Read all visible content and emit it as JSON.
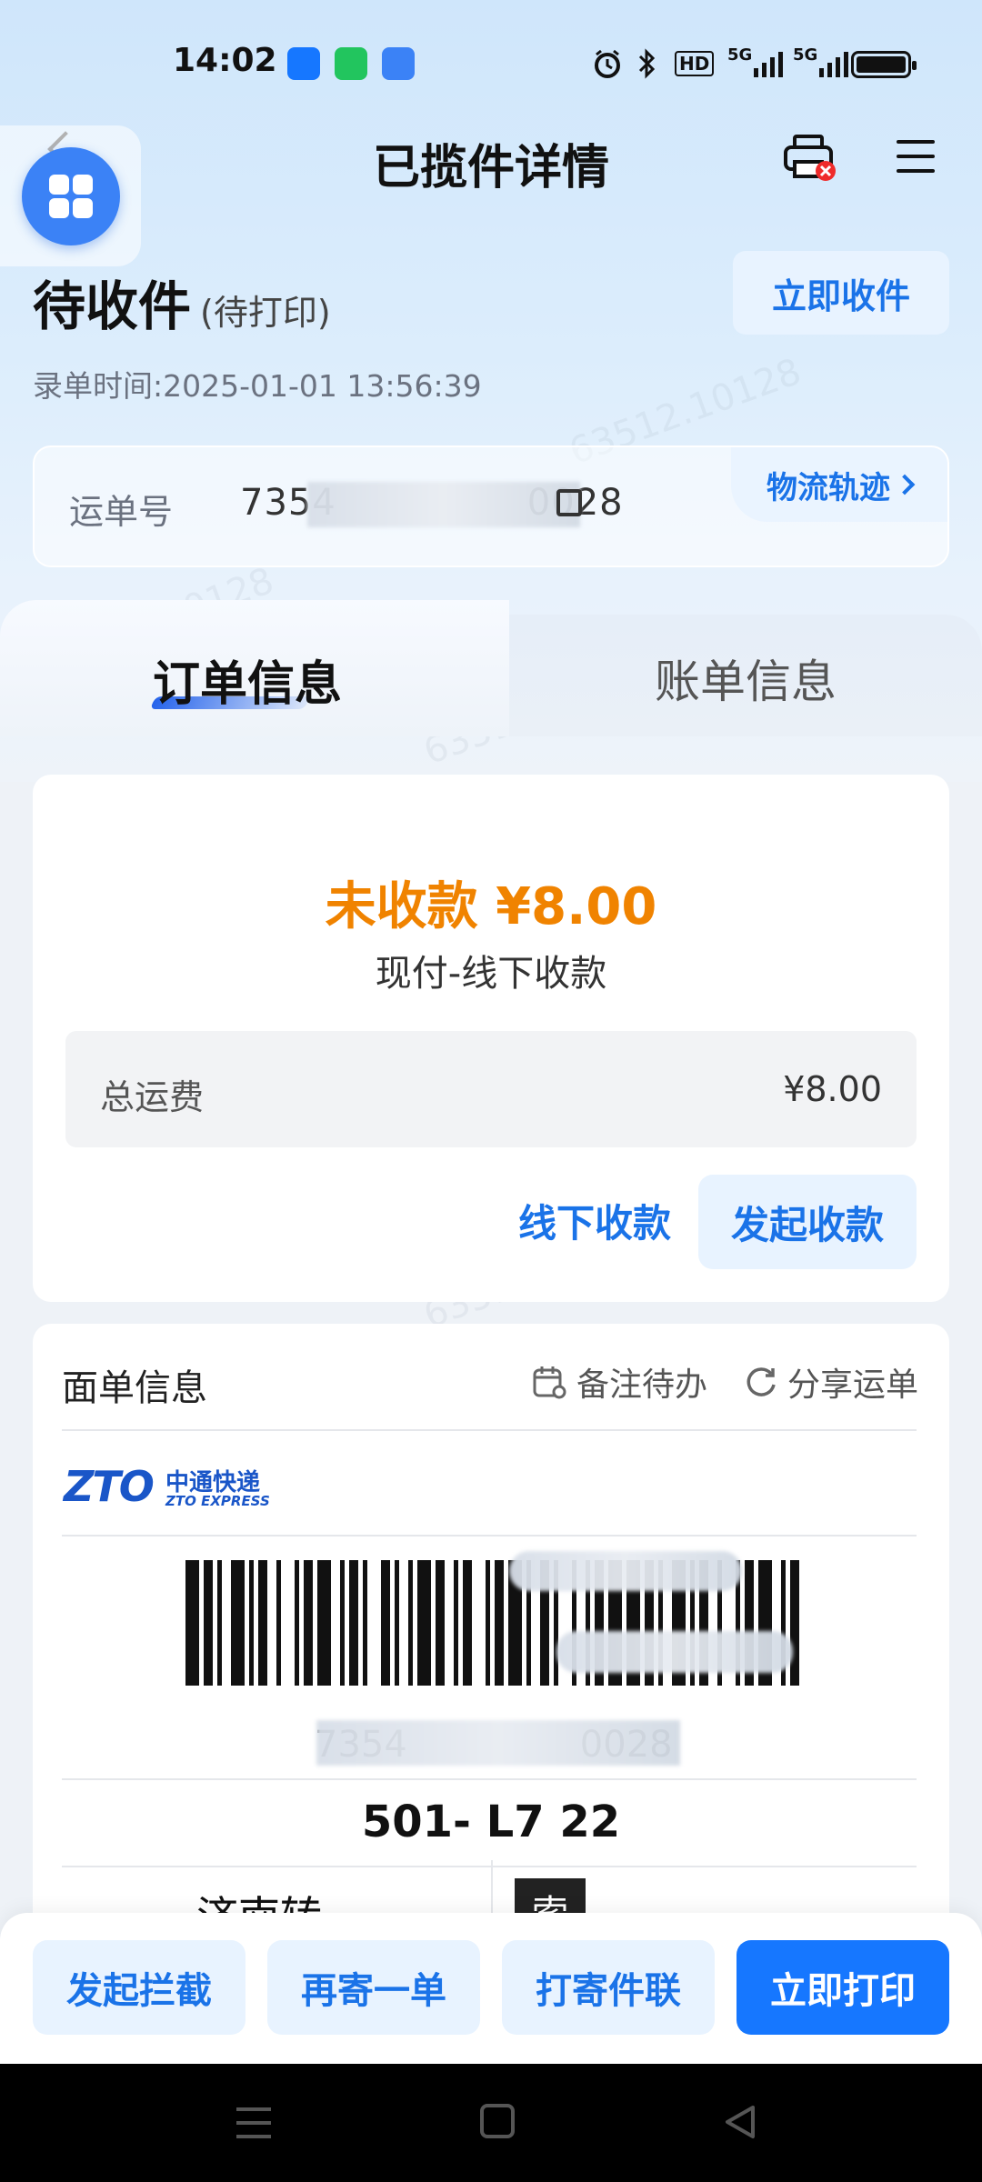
{
  "status_bar": {
    "time": "14:02",
    "network_label": "5G",
    "hd_label": "HD",
    "app_icon_colors": [
      "#1677ff",
      "#22c55e",
      "#3b82f6"
    ]
  },
  "nav": {
    "title": "已揽件详情"
  },
  "order_status": {
    "title": "待收件",
    "subtitle": "(待打印)",
    "collect_button": "立即收件",
    "record_time_label": "录单时间:",
    "record_time": "2025-01-01 13:56:39"
  },
  "waybill": {
    "label": "运单号",
    "number_visible_start": "7354",
    "number_visible_end": "0028",
    "track_button": "物流轨迹"
  },
  "tabs": [
    {
      "label": "订单信息",
      "active": true
    },
    {
      "label": "账单信息",
      "active": false
    }
  ],
  "payment": {
    "title": "未收款 ¥8.00",
    "method": "现付-线下收款",
    "fee_label": "总运费",
    "fee_value": "¥8.00",
    "offline_button": "线下收款",
    "start_button": "发起收款",
    "accent": "#f08300"
  },
  "sheet": {
    "title": "面单信息",
    "note_action": "备注待办",
    "share_action": "分享运单",
    "brand_cn": "中通快递",
    "brand_en": "ZTO EXPRESS",
    "brand_logo": "ZTO",
    "code_visible_start": "7354",
    "code_visible_end": "0028",
    "route_code": "501- L7 22",
    "city": "济南转",
    "tag": "索"
  },
  "bottom_actions": [
    {
      "label": "发起拦截",
      "style": "light"
    },
    {
      "label": "再寄一单",
      "style": "light"
    },
    {
      "label": "打寄件联",
      "style": "light"
    },
    {
      "label": "立即打印",
      "style": "primary"
    }
  ],
  "watermark_text": "63512.10128",
  "colors": {
    "primary": "#1677ff",
    "link": "#1a73e8"
  }
}
